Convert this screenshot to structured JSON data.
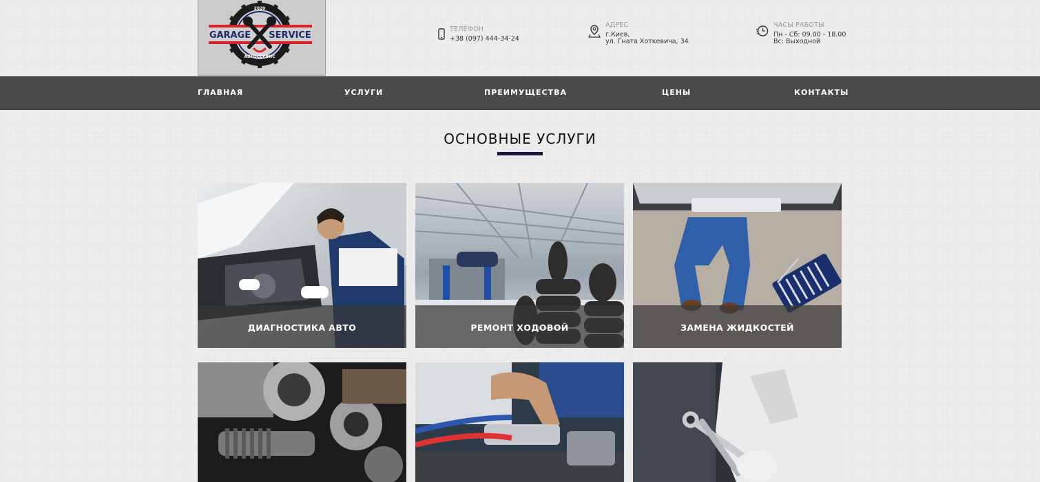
{
  "brand": {
    "logo_left": "GARAGE",
    "logo_right": "SERVICE",
    "logo_year": "2020",
    "logo_sub": "АВТОСЕРВИС"
  },
  "contacts": {
    "phone": {
      "label": "ТЕЛЕФОН",
      "value": "+38 (097) 444-34-24",
      "icon": "phone-icon"
    },
    "address": {
      "label": "АДРЕС",
      "line1": "г.Киев,",
      "line2": "ул. Гната Хоткевича, 34",
      "icon": "map-pin-icon"
    },
    "hours": {
      "label": "ЧАСЫ РАБОТЫ",
      "line1": "Пн - Сб: 09.00 - 18.00",
      "line2": "Вс: Выходной",
      "icon": "clock-icon"
    }
  },
  "nav": {
    "items": [
      "ГЛАВНАЯ",
      "УСЛУГИ",
      "ПРЕИМУЩЕСТВА",
      "ЦЕНЫ",
      "КОНТАКТЫ"
    ]
  },
  "services": {
    "title": "ОСНОВНЫЕ УСЛУГИ",
    "cards": [
      "ДИАГНОСТИКА АВТО",
      "РЕМОНТ ХОДОВОЙ",
      "ЗАМЕНА ЖИДКОСТЕЙ",
      "",
      "",
      ""
    ]
  },
  "colors": {
    "nav_bg": "#4a4a4a",
    "accent_bar": "#15183f",
    "logo_red": "#d8222a",
    "logo_navy": "#1c2a6b"
  }
}
